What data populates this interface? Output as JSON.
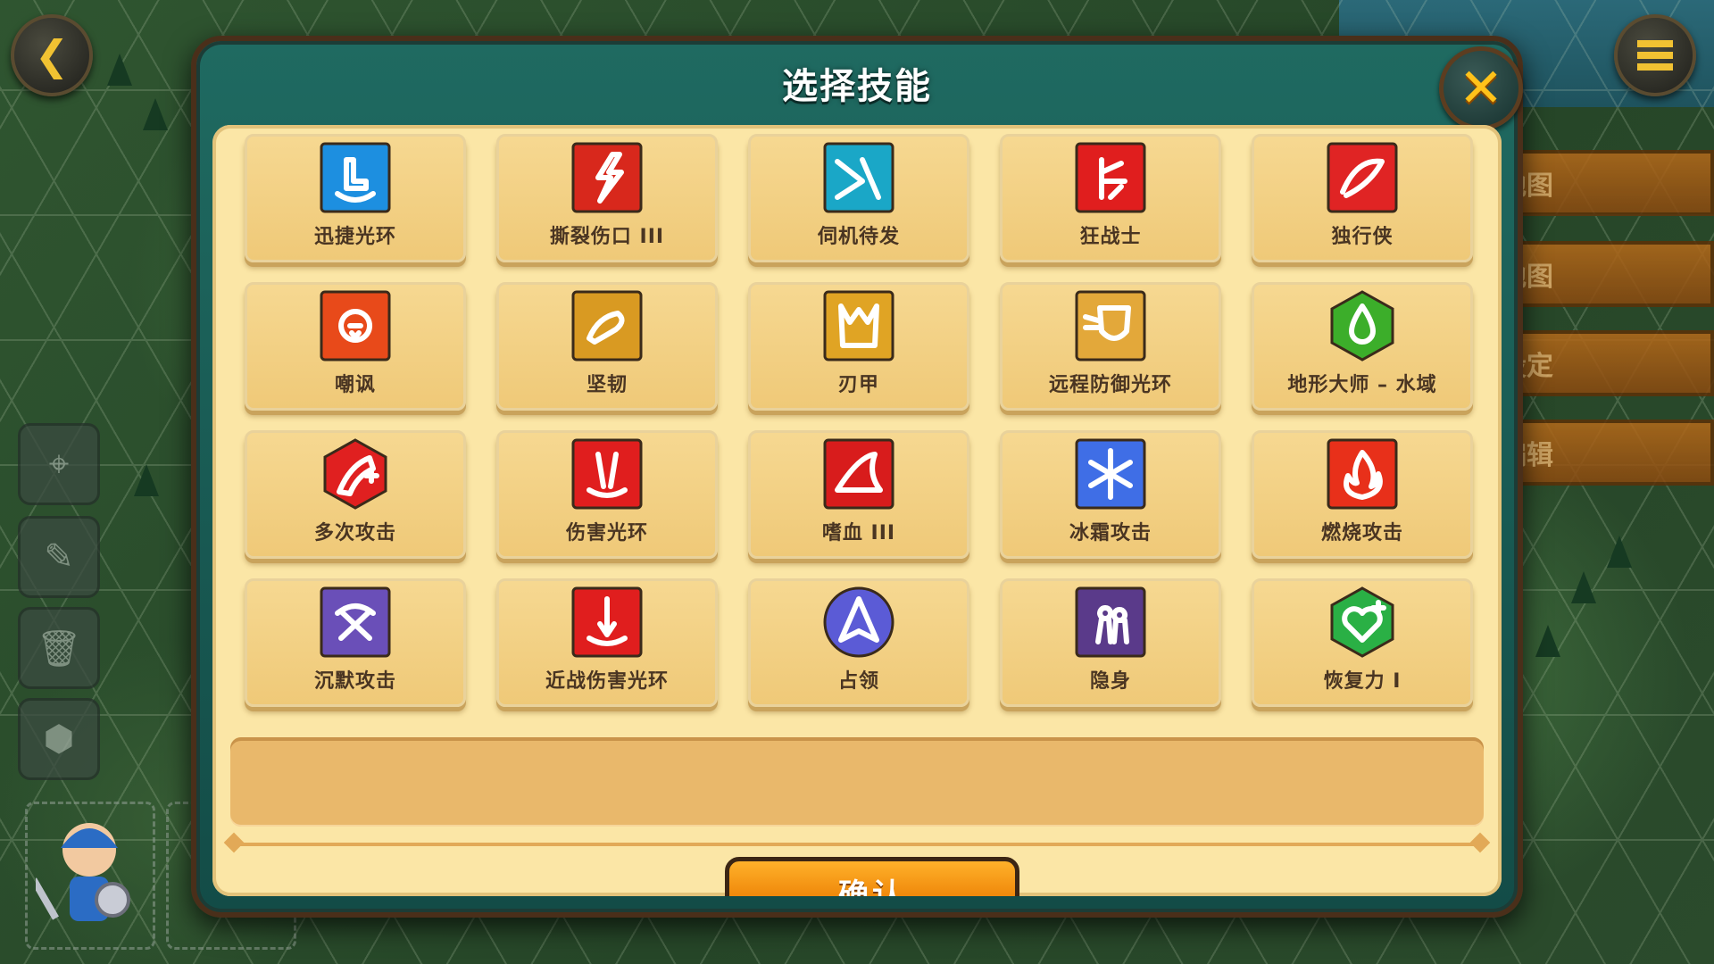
{
  "dialog": {
    "title": "选择技能",
    "confirm_label": "确认"
  },
  "skills": [
    {
      "name": "迅捷光环",
      "icon": "speed-aura-icon",
      "color": "#1d8fe0"
    },
    {
      "name": "撕裂伤口 III",
      "icon": "rend-wound-icon",
      "color": "#d8281c"
    },
    {
      "name": "伺机待发",
      "icon": "ambush-icon",
      "color": "#1aa7c7"
    },
    {
      "name": "狂战士",
      "icon": "berserker-icon",
      "color": "#e01e1e"
    },
    {
      "name": "独行侠",
      "icon": "lone-ranger-icon",
      "color": "#e02424"
    },
    {
      "name": "嘲讽",
      "icon": "taunt-icon",
      "color": "#e84a1a"
    },
    {
      "name": "坚韧",
      "icon": "toughness-icon",
      "color": "#d99a22"
    },
    {
      "name": "刃甲",
      "icon": "blade-armor-icon",
      "color": "#e0a424"
    },
    {
      "name": "远程防御光环",
      "icon": "ranged-defense-aura-icon",
      "color": "#e3a83a"
    },
    {
      "name": "地形大师 – 水域",
      "icon": "terrain-master-water-icon",
      "color": "#3cae2a"
    },
    {
      "name": "多次攻击",
      "icon": "multi-attack-icon",
      "color": "#e02020"
    },
    {
      "name": "伤害光环",
      "icon": "damage-aura-icon",
      "color": "#e01e1e"
    },
    {
      "name": "嗜血 III",
      "icon": "bloodlust-icon",
      "color": "#d81c1c"
    },
    {
      "name": "冰霜攻击",
      "icon": "frost-attack-icon",
      "color": "#3f6ee6"
    },
    {
      "name": "燃烧攻击",
      "icon": "burn-attack-icon",
      "color": "#e8301a"
    },
    {
      "name": "沉默攻击",
      "icon": "silence-attack-icon",
      "color": "#6a4fb8"
    },
    {
      "name": "近战伤害光环",
      "icon": "melee-damage-aura-icon",
      "color": "#e01e1e"
    },
    {
      "name": "占领",
      "icon": "occupy-icon",
      "color": "#5b5bd6"
    },
    {
      "name": "隐身",
      "icon": "stealth-icon",
      "color": "#5a3a8a"
    },
    {
      "name": "恢复力 I",
      "icon": "recovery-icon",
      "color": "#2ab045"
    }
  ],
  "background": {
    "right_tabs": [
      "地图",
      "地图",
      "设定",
      "编辑"
    ]
  }
}
